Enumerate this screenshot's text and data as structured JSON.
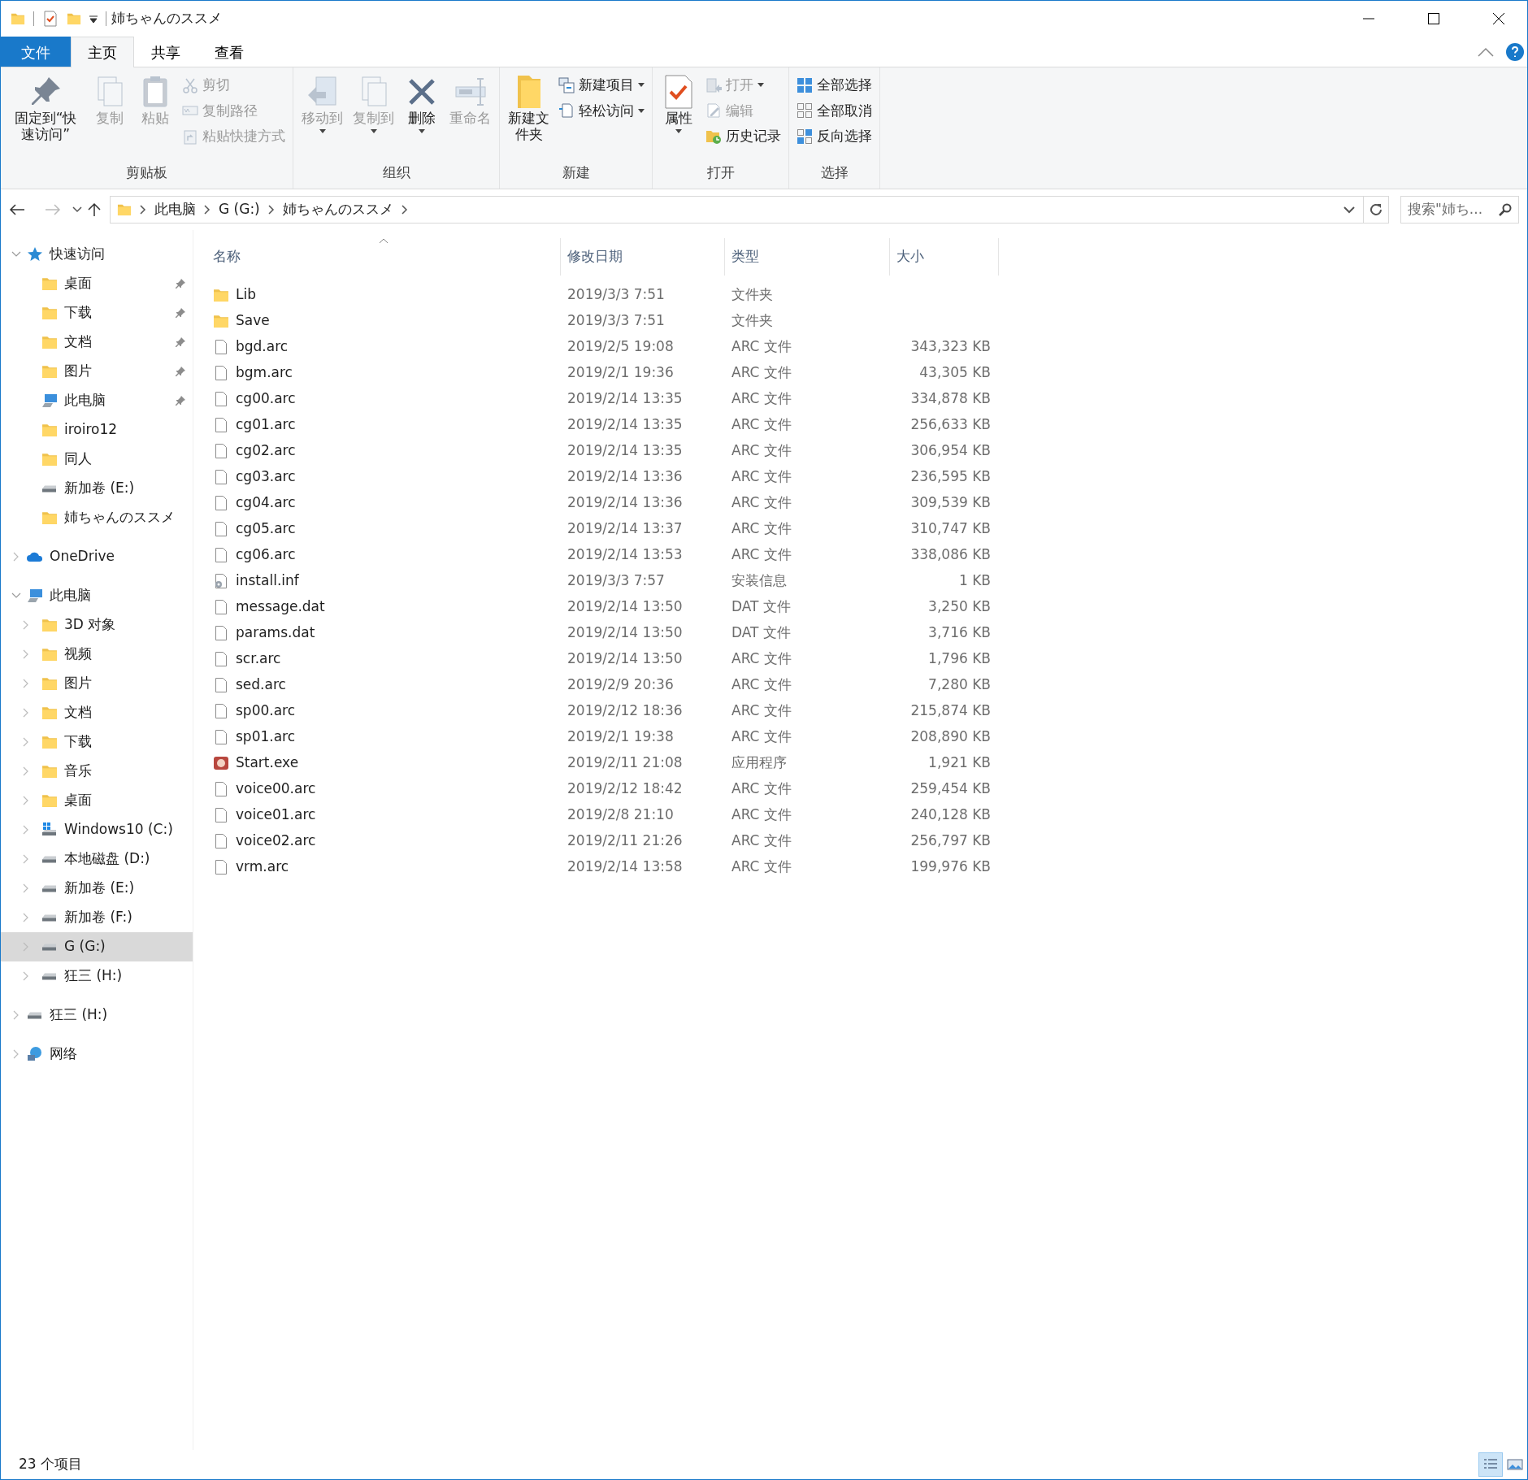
{
  "window": {
    "title": "姉ちゃんのススメ"
  },
  "ribbon_tabs": [
    {
      "label": "文件",
      "kind": "file",
      "selected": false
    },
    {
      "label": "主页",
      "kind": "tab",
      "selected": true
    },
    {
      "label": "共享",
      "kind": "tab",
      "selected": false
    },
    {
      "label": "查看",
      "kind": "tab",
      "selected": false
    }
  ],
  "ribbon_groups": [
    {
      "label": "剪贴板",
      "buttons": [
        {
          "kind": "large",
          "label": "固定到“快速访问”",
          "disabled": false
        },
        {
          "kind": "large",
          "label": "复制",
          "disabled": true
        },
        {
          "kind": "large",
          "label": "粘贴",
          "disabled": true
        },
        {
          "kind": "small",
          "label": "剪切",
          "disabled": true
        },
        {
          "kind": "small",
          "label": "复制路径",
          "disabled": true
        },
        {
          "kind": "small",
          "label": "粘贴快捷方式",
          "disabled": true
        }
      ]
    },
    {
      "label": "组织",
      "buttons": [
        {
          "kind": "large",
          "label": "移动到",
          "disabled": true,
          "dropdown": true
        },
        {
          "kind": "large",
          "label": "复制到",
          "disabled": true,
          "dropdown": true
        },
        {
          "kind": "large",
          "label": "删除",
          "disabled": false,
          "dropdown": true
        },
        {
          "kind": "large",
          "label": "重命名",
          "disabled": true
        }
      ]
    },
    {
      "label": "新建",
      "buttons": [
        {
          "kind": "large",
          "label": "新建文件夹",
          "disabled": false
        },
        {
          "kind": "small",
          "label": "新建项目",
          "disabled": false,
          "dropdown": true
        },
        {
          "kind": "small",
          "label": "轻松访问",
          "disabled": false,
          "dropdown": true
        }
      ]
    },
    {
      "label": "打开",
      "buttons": [
        {
          "kind": "large",
          "label": "属性",
          "disabled": false,
          "dropdown": true
        },
        {
          "kind": "small",
          "label": "打开",
          "disabled": true,
          "dropdown": true
        },
        {
          "kind": "small",
          "label": "编辑",
          "disabled": true
        },
        {
          "kind": "small",
          "label": "历史记录",
          "disabled": false
        }
      ]
    },
    {
      "label": "选择",
      "buttons": [
        {
          "kind": "small",
          "label": "全部选择",
          "disabled": false
        },
        {
          "kind": "small",
          "label": "全部取消",
          "disabled": false
        },
        {
          "kind": "small",
          "label": "反向选择",
          "disabled": false
        }
      ]
    }
  ],
  "address_bar": {
    "crumbs": [
      "此电脑",
      "G (G:)",
      "姉ちゃんのススメ"
    ]
  },
  "search": {
    "placeholder": "搜索\"姉ち..."
  },
  "sidebar": {
    "sections": [
      {
        "kind": "star",
        "label": "快速访问",
        "expanded": true,
        "selected": false,
        "children": [
          {
            "kind": "folder",
            "label": "桌面",
            "pinned": true,
            "selected": false
          },
          {
            "kind": "folder",
            "label": "下载",
            "pinned": true,
            "selected": false
          },
          {
            "kind": "folder",
            "label": "文档",
            "pinned": true,
            "selected": false
          },
          {
            "kind": "folder",
            "label": "图片",
            "pinned": true,
            "selected": false
          },
          {
            "kind": "pc",
            "label": "此电脑",
            "pinned": true,
            "selected": false
          },
          {
            "kind": "folder",
            "label": "iroiro12",
            "pinned": false,
            "selected": false
          },
          {
            "kind": "folder",
            "label": "同人",
            "pinned": false,
            "selected": false
          },
          {
            "kind": "drive",
            "label": "新加卷 (E:)",
            "pinned": false,
            "selected": false
          },
          {
            "kind": "folder",
            "label": "姉ちゃんのススメ",
            "pinned": false,
            "selected": false
          }
        ]
      },
      {
        "kind": "cloud",
        "label": "OneDrive",
        "expanded": false,
        "selected": false
      },
      {
        "kind": "pc",
        "label": "此电脑",
        "expanded": true,
        "selected": false,
        "children": [
          {
            "kind": "folder",
            "label": "3D 对象",
            "expanded": false,
            "selected": false
          },
          {
            "kind": "folder",
            "label": "视频",
            "expanded": false,
            "selected": false
          },
          {
            "kind": "folder",
            "label": "图片",
            "expanded": false,
            "selected": false
          },
          {
            "kind": "folder",
            "label": "文档",
            "expanded": false,
            "selected": false
          },
          {
            "kind": "folder",
            "label": "下载",
            "expanded": false,
            "selected": false
          },
          {
            "kind": "folder",
            "label": "音乐",
            "expanded": false,
            "selected": false
          },
          {
            "kind": "folder",
            "label": "桌面",
            "expanded": false,
            "selected": false
          },
          {
            "kind": "windrive",
            "label": "Windows10 (C:)",
            "expanded": false,
            "selected": false
          },
          {
            "kind": "drive",
            "label": "本地磁盘 (D:)",
            "expanded": false,
            "selected": false
          },
          {
            "kind": "drive",
            "label": "新加卷 (E:)",
            "expanded": false,
            "selected": false
          },
          {
            "kind": "drive",
            "label": "新加卷 (F:)",
            "expanded": false,
            "selected": false
          },
          {
            "kind": "drive",
            "label": "G (G:)",
            "expanded": false,
            "selected": true
          },
          {
            "kind": "drive",
            "label": "狂三 (H:)",
            "expanded": false,
            "selected": false
          }
        ]
      },
      {
        "kind": "drive",
        "label": "狂三 (H:)",
        "expanded": false,
        "selected": false
      },
      {
        "kind": "network",
        "label": "网络",
        "expanded": false,
        "selected": false
      }
    ]
  },
  "file_list": {
    "columns": [
      "名称",
      "修改日期",
      "类型",
      "大小"
    ],
    "rows": [
      {
        "kind": "folder",
        "name": "Lib",
        "modified": "2019/3/3 7:51",
        "type": "文件夹"
      },
      {
        "kind": "folder",
        "name": "Save",
        "modified": "2019/3/3 7:51",
        "type": "文件夹"
      },
      {
        "kind": "file",
        "name": "bgd.arc",
        "modified": "2019/2/5 19:08",
        "type": "ARC 文件",
        "size": "343,323 KB"
      },
      {
        "kind": "file",
        "name": "bgm.arc",
        "modified": "2019/2/1 19:36",
        "type": "ARC 文件",
        "size": "43,305 KB"
      },
      {
        "kind": "file",
        "name": "cg00.arc",
        "modified": "2019/2/14 13:35",
        "type": "ARC 文件",
        "size": "334,878 KB"
      },
      {
        "kind": "file",
        "name": "cg01.arc",
        "modified": "2019/2/14 13:35",
        "type": "ARC 文件",
        "size": "256,633 KB"
      },
      {
        "kind": "file",
        "name": "cg02.arc",
        "modified": "2019/2/14 13:35",
        "type": "ARC 文件",
        "size": "306,954 KB"
      },
      {
        "kind": "file",
        "name": "cg03.arc",
        "modified": "2019/2/14 13:36",
        "type": "ARC 文件",
        "size": "236,595 KB"
      },
      {
        "kind": "file",
        "name": "cg04.arc",
        "modified": "2019/2/14 13:36",
        "type": "ARC 文件",
        "size": "309,539 KB"
      },
      {
        "kind": "file",
        "name": "cg05.arc",
        "modified": "2019/2/14 13:37",
        "type": "ARC 文件",
        "size": "310,747 KB"
      },
      {
        "kind": "file",
        "name": "cg06.arc",
        "modified": "2019/2/14 13:53",
        "type": "ARC 文件",
        "size": "338,086 KB"
      },
      {
        "kind": "setup",
        "name": "install.inf",
        "modified": "2019/3/3 7:57",
        "type": "安装信息",
        "size": "1 KB"
      },
      {
        "kind": "file",
        "name": "message.dat",
        "modified": "2019/2/14 13:50",
        "type": "DAT 文件",
        "size": "3,250 KB"
      },
      {
        "kind": "file",
        "name": "params.dat",
        "modified": "2019/2/14 13:50",
        "type": "DAT 文件",
        "size": "3,716 KB"
      },
      {
        "kind": "file",
        "name": "scr.arc",
        "modified": "2019/2/14 13:50",
        "type": "ARC 文件",
        "size": "1,796 KB"
      },
      {
        "kind": "file",
        "name": "sed.arc",
        "modified": "2019/2/9 20:36",
        "type": "ARC 文件",
        "size": "7,280 KB"
      },
      {
        "kind": "file",
        "name": "sp00.arc",
        "modified": "2019/2/12 18:36",
        "type": "ARC 文件",
        "size": "215,874 KB"
      },
      {
        "kind": "file",
        "name": "sp01.arc",
        "modified": "2019/2/1 19:38",
        "type": "ARC 文件",
        "size": "208,890 KB"
      },
      {
        "kind": "app",
        "name": "Start.exe",
        "modified": "2019/2/11 21:08",
        "type": "应用程序",
        "size": "1,921 KB"
      },
      {
        "kind": "file",
        "name": "voice00.arc",
        "modified": "2019/2/12 18:42",
        "type": "ARC 文件",
        "size": "259,454 KB"
      },
      {
        "kind": "file",
        "name": "voice01.arc",
        "modified": "2019/2/8 21:10",
        "type": "ARC 文件",
        "size": "240,128 KB"
      },
      {
        "kind": "file",
        "name": "voice02.arc",
        "modified": "2019/2/11 21:26",
        "type": "ARC 文件",
        "size": "256,797 KB"
      },
      {
        "kind": "file",
        "name": "vrm.arc",
        "modified": "2019/2/14 13:58",
        "type": "ARC 文件",
        "size": "199,976 KB"
      }
    ]
  },
  "status_bar": {
    "item_count": "23 个项目"
  },
  "view_buttons": [
    {
      "kind": "details",
      "selected": true
    },
    {
      "kind": "thumbnails",
      "selected": false
    }
  ]
}
